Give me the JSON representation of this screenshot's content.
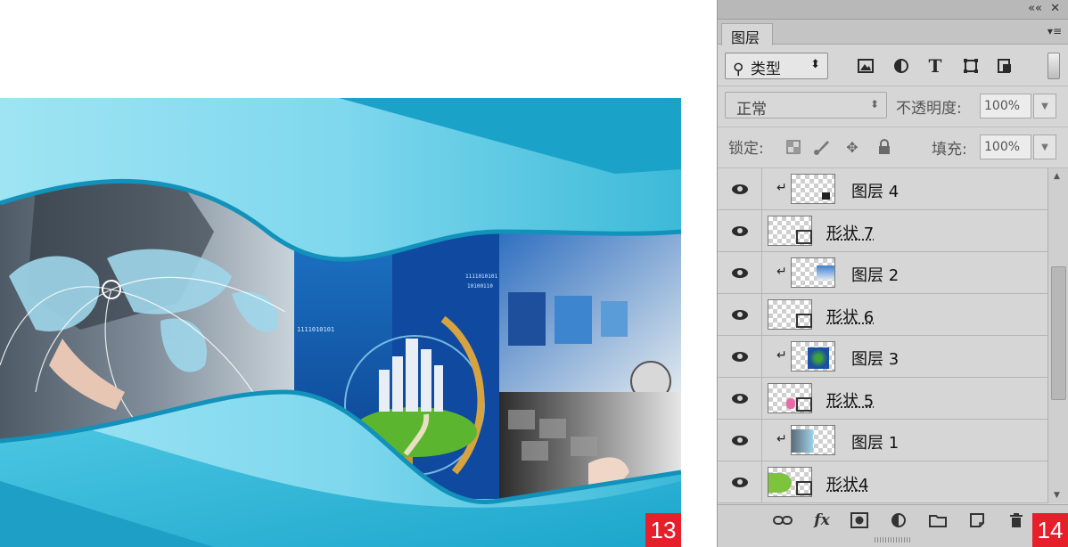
{
  "artwork": {
    "binary_text_1": "1111010101",
    "binary_text_2": "1111010101",
    "binary_text_3": "10100110",
    "badge_number": "13"
  },
  "panel": {
    "badge_number": "14",
    "collapse_glyph": "««",
    "close_glyph": "✕",
    "tab_label": "图层",
    "menu_glyph": "▾≡",
    "filter": {
      "kind_label": "类型",
      "icons": [
        "image-filter-icon",
        "adjustment-filter-icon",
        "type-filter-icon",
        "shape-filter-icon",
        "smart-object-filter-icon"
      ]
    },
    "blend_mode": "正常",
    "opacity_label": "不透明度:",
    "opacity_value": "100%",
    "lock_label": "锁定:",
    "fill_label": "填充:",
    "fill_value": "100%",
    "layers": [
      {
        "name": "图层 4",
        "clipped": true
      },
      {
        "name": "形状 7",
        "clipped": false
      },
      {
        "name": "图层 2",
        "clipped": true
      },
      {
        "name": "形状 6",
        "clipped": false
      },
      {
        "name": "图层 3",
        "clipped": true
      },
      {
        "name": "形状 5",
        "clipped": false
      },
      {
        "name": "图层 1",
        "clipped": true
      },
      {
        "name": "形状4",
        "clipped": false
      }
    ]
  },
  "colors": {
    "accent_blue": "#1b9ec9",
    "badge_red": "#e5202b",
    "panel_bg": "#d6d6d6"
  }
}
